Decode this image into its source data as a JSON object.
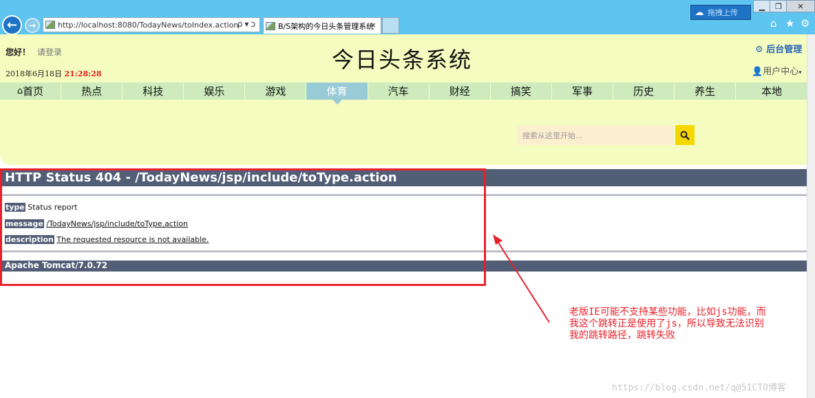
{
  "browser": {
    "url": "http://localhost:8080/TodayNews/toIndex.action",
    "tab_title": "B/S架构的今日头条管理系统",
    "upload_label": "拖拽上传",
    "address_tools": "ρ▾ↄ",
    "tab_close": "×"
  },
  "site": {
    "greeting": "您好！",
    "login": "请登录",
    "date": "2018年6月18日",
    "time": "21:28:28",
    "title": "今日头条系统",
    "admin": "后台管理",
    "user_center": "用户中心",
    "search_placeholder": "搜索从这里开始...",
    "nav": [
      "首页",
      "热点",
      "科技",
      "娱乐",
      "游戏",
      "体育",
      "汽车",
      "财经",
      "搞笑",
      "军事",
      "历史",
      "养生",
      "本地"
    ],
    "active_nav": "体育"
  },
  "error": {
    "title": "HTTP Status 404 - /TodayNews/jsp/include/toType.action",
    "type_label": "type",
    "type_value": "Status report",
    "message_label": "message",
    "message_value": "/TodayNews/jsp/include/toType.action",
    "description_label": "description",
    "description_value": "The requested resource is not available.",
    "footer": "Apache Tomcat/7.0.72"
  },
  "annotation": {
    "text": "老版IE可能不支持某些功能，比如js功能，而\n我这个跳转正是使用了js，所以导致无法识别\n我的跳转路径，跳转失败"
  },
  "watermark": "https://blog.csdn.net/q@51CTO博客",
  "colors": {
    "chrome": "#5ec4f0",
    "header_bg": "#f4fdbf",
    "nav_bg": "#cdebbc",
    "nav_active": "#99cbd6",
    "tomcat_bar": "#525d76",
    "annotation_red": "#e8202a"
  }
}
